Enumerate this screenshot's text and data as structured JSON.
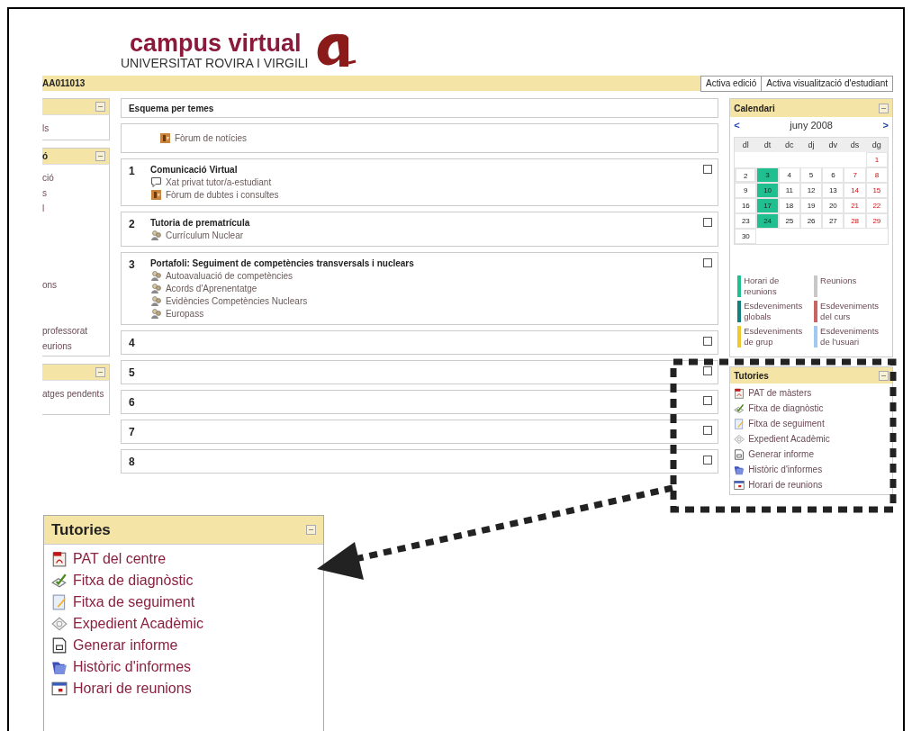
{
  "logo": {
    "title": "campus virtual",
    "subtitle": "UNIVERSITAT ROVIRA I VIRGILI"
  },
  "course_code": "AA011013",
  "buttons": [
    "Activa edició",
    "Activa visualització d'estudiant"
  ],
  "left_blocks": [
    {
      "items": [
        "ls"
      ]
    },
    {
      "title": "ó",
      "items": [
        "ció",
        "s",
        "l",
        "ons",
        "professorat",
        "eurions"
      ]
    },
    {
      "items": [
        "atges pendents"
      ]
    }
  ],
  "outline": {
    "title": "Esquema per temes",
    "sections": [
      {
        "activities": [
          {
            "kind": "forum",
            "label": "Fòrum de notícies"
          }
        ]
      },
      {
        "number": "1",
        "title": "Comunicació Virtual",
        "checked": false,
        "activities": [
          {
            "kind": "chat",
            "label": "Xat privat tutor/a-estudiant"
          },
          {
            "kind": "forum",
            "label": "Fòrum de dubtes i consultes"
          }
        ]
      },
      {
        "number": "2",
        "title": "Tutoria de prematrícula",
        "checked": false,
        "activities": [
          {
            "kind": "resource",
            "label": "Currículum Nuclear"
          }
        ]
      },
      {
        "number": "3",
        "title": "Portafoli: Seguiment de competències transversals i nuclears",
        "checked": false,
        "activities": [
          {
            "kind": "resource",
            "label": "Autoavaluació de competències"
          },
          {
            "kind": "resource",
            "label": "Acords d'Aprenentatge"
          },
          {
            "kind": "resource",
            "label": "Evidències Competències Nuclears"
          },
          {
            "kind": "resource",
            "label": "Europass"
          }
        ]
      },
      {
        "number": "4",
        "checked": false
      },
      {
        "number": "5",
        "checked": false
      },
      {
        "number": "6",
        "checked": false
      },
      {
        "number": "7",
        "checked": false
      },
      {
        "number": "8",
        "checked": false
      }
    ]
  },
  "calendar": {
    "title": "Calendari",
    "prev": "<",
    "month": "juny 2008",
    "next": ">",
    "weekdays": [
      "dl",
      "dt",
      "dc",
      "dj",
      "dv",
      "ds",
      "dg"
    ],
    "weeks": [
      [
        {
          "day": "1",
          "weekend": true,
          "event": false,
          "today": false
        }
      ],
      [
        {
          "day": "2",
          "weekend": false,
          "event": false,
          "today": true
        },
        {
          "day": "3",
          "weekend": false,
          "event": true,
          "today": false
        },
        {
          "day": "4",
          "weekend": false,
          "event": false,
          "today": false
        },
        {
          "day": "5",
          "weekend": false,
          "event": false,
          "today": false
        },
        {
          "day": "6",
          "weekend": false,
          "event": false,
          "today": false
        },
        {
          "day": "7",
          "weekend": true,
          "event": false,
          "today": false
        },
        {
          "day": "8",
          "weekend": true,
          "event": false,
          "today": false
        }
      ],
      [
        {
          "day": "9",
          "weekend": false,
          "event": false,
          "today": false
        },
        {
          "day": "10",
          "weekend": false,
          "event": true,
          "today": false
        },
        {
          "day": "11",
          "weekend": false,
          "event": false,
          "today": false
        },
        {
          "day": "12",
          "weekend": false,
          "event": false,
          "today": false
        },
        {
          "day": "13",
          "weekend": false,
          "event": false,
          "today": false
        },
        {
          "day": "14",
          "weekend": true,
          "event": false,
          "today": false
        },
        {
          "day": "15",
          "weekend": true,
          "event": false,
          "today": false
        }
      ],
      [
        {
          "day": "16",
          "weekend": false,
          "event": false,
          "today": false
        },
        {
          "day": "17",
          "weekend": false,
          "event": true,
          "today": false
        },
        {
          "day": "18",
          "weekend": false,
          "event": false,
          "today": false
        },
        {
          "day": "19",
          "weekend": false,
          "event": false,
          "today": false
        },
        {
          "day": "20",
          "weekend": false,
          "event": false,
          "today": false
        },
        {
          "day": "21",
          "weekend": true,
          "event": false,
          "today": false
        },
        {
          "day": "22",
          "weekend": true,
          "event": false,
          "today": false
        }
      ],
      [
        {
          "day": "23",
          "weekend": false,
          "event": false,
          "today": false
        },
        {
          "day": "24",
          "weekend": false,
          "event": true,
          "today": false
        },
        {
          "day": "25",
          "weekend": false,
          "event": false,
          "today": false
        },
        {
          "day": "26",
          "weekend": false,
          "event": false,
          "today": false
        },
        {
          "day": "27",
          "weekend": false,
          "event": false,
          "today": false
        },
        {
          "day": "28",
          "weekend": true,
          "event": false,
          "today": false
        },
        {
          "day": "29",
          "weekend": true,
          "event": false,
          "today": false
        }
      ],
      [
        {
          "day": "30",
          "weekend": false,
          "event": false,
          "today": false
        }
      ]
    ],
    "legend": [
      {
        "label": "Horari de reunions",
        "color": "#1fbf8f"
      },
      {
        "label": "Reunions",
        "color": "#c8c8c8"
      },
      {
        "label": "Esdeveniments globals",
        "color": "#128080"
      },
      {
        "label": "Esdeveniments del curs",
        "color": "#c86464"
      },
      {
        "label": "Esdeveniments de grup",
        "color": "#f0c830"
      },
      {
        "label": "Esdeveniments de l'usuari",
        "color": "#a0c8f0"
      }
    ]
  },
  "tutories": {
    "title": "Tutories",
    "items": [
      {
        "kind": "pdf",
        "label": "PAT de màsters"
      },
      {
        "kind": "check",
        "label": "Fitxa de diagnòstic"
      },
      {
        "kind": "note",
        "label": "Fitxa de seguiment"
      },
      {
        "kind": "certificate",
        "label": "Expedient Acadèmic"
      },
      {
        "kind": "report",
        "label": "Generar informe"
      },
      {
        "kind": "folder",
        "label": "Històric d'informes"
      },
      {
        "kind": "calendar",
        "label": "Horari de reunions"
      }
    ]
  },
  "inset": {
    "title": "Tutories",
    "items": [
      {
        "kind": "pdf",
        "label": "PAT del centre"
      },
      {
        "kind": "check",
        "label": "Fitxa de diagnòstic"
      },
      {
        "kind": "note",
        "label": "Fitxa de seguiment"
      },
      {
        "kind": "certificate",
        "label": "Expedient Acadèmic"
      },
      {
        "kind": "report",
        "label": "Generar informe"
      },
      {
        "kind": "folder",
        "label": "Històric d'informes"
      },
      {
        "kind": "calendar",
        "label": "Horari de reunions"
      }
    ]
  }
}
